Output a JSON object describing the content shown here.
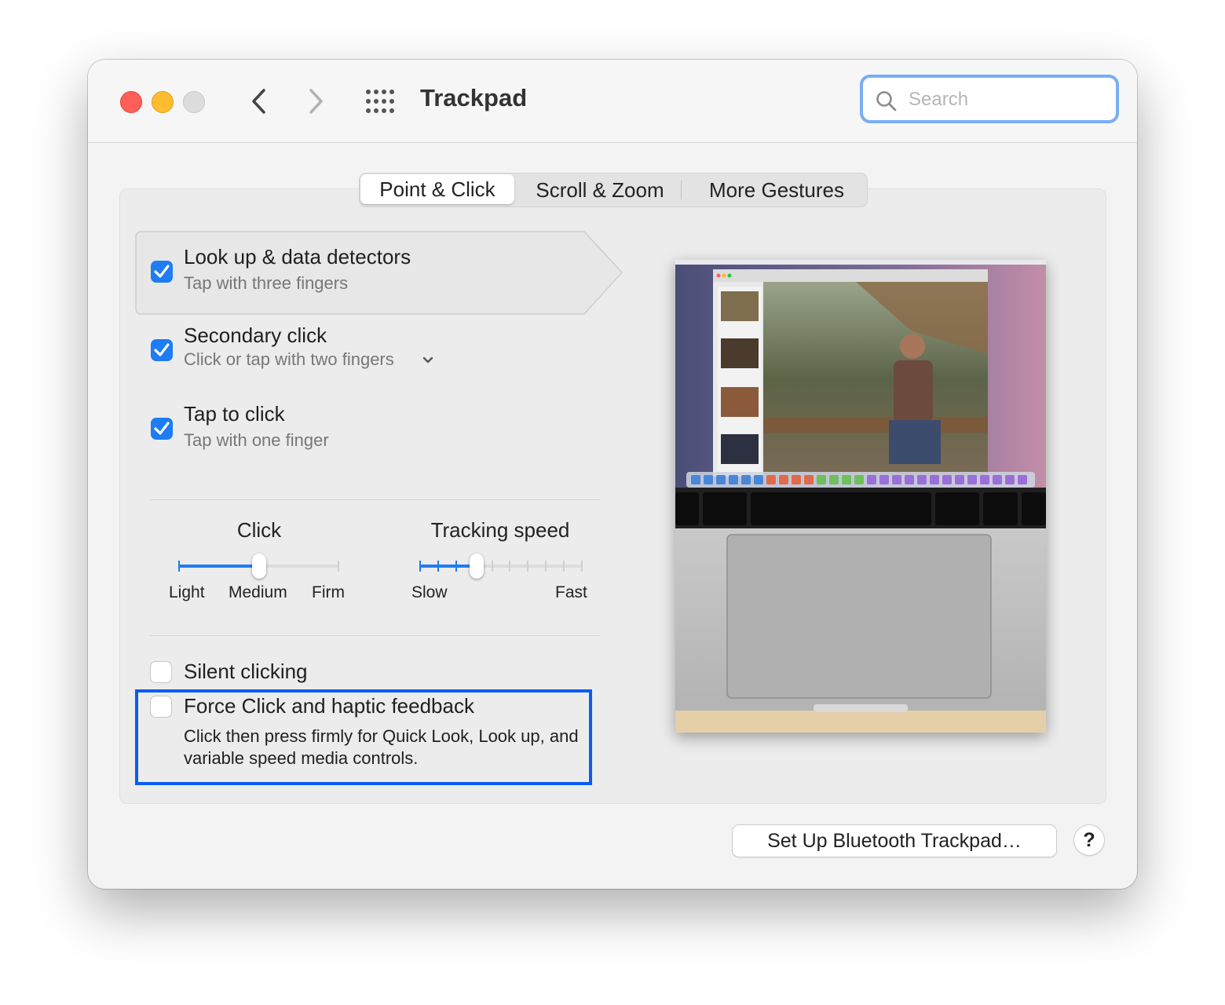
{
  "window": {
    "title": "Trackpad"
  },
  "toolbar": {
    "back_icon": "chevron-left-icon",
    "forward_icon": "chevron-right-icon",
    "grid_icon": "show-all-grid-icon"
  },
  "search": {
    "placeholder": "Search",
    "value": ""
  },
  "tabs": [
    {
      "label": "Point & Click",
      "selected": true
    },
    {
      "label": "Scroll & Zoom",
      "selected": false
    },
    {
      "label": "More Gestures",
      "selected": false
    }
  ],
  "options": {
    "lookup": {
      "title": "Look up & data detectors",
      "subtitle": "Tap with three fingers",
      "checked": true
    },
    "secondary": {
      "title": "Secondary click",
      "subtitle": "Click or tap with two fingers",
      "checked": true
    },
    "tap": {
      "title": "Tap to click",
      "subtitle": "Tap with one finger",
      "checked": true
    },
    "silent": {
      "title": "Silent clicking",
      "checked": false
    },
    "force": {
      "title": "Force Click and haptic feedback",
      "description": "Click then press firmly for Quick Look, Look up, and variable speed media controls.",
      "checked": false
    }
  },
  "sliders": {
    "click": {
      "label": "Click",
      "ticks": [
        "Light",
        "Medium",
        "Firm"
      ],
      "value": "Medium",
      "fraction": 0.5
    },
    "tracking": {
      "label": "Tracking speed",
      "min_label": "Slow",
      "max_label": "Fast",
      "fraction": 0.35
    }
  },
  "buttons": {
    "bluetooth": "Set Up Bluetooth Trackpad…",
    "help": "?"
  },
  "colors": {
    "accent": "#1e7cf4",
    "highlight_box": "#0a5cf0",
    "search_focus": "#78aef4"
  }
}
